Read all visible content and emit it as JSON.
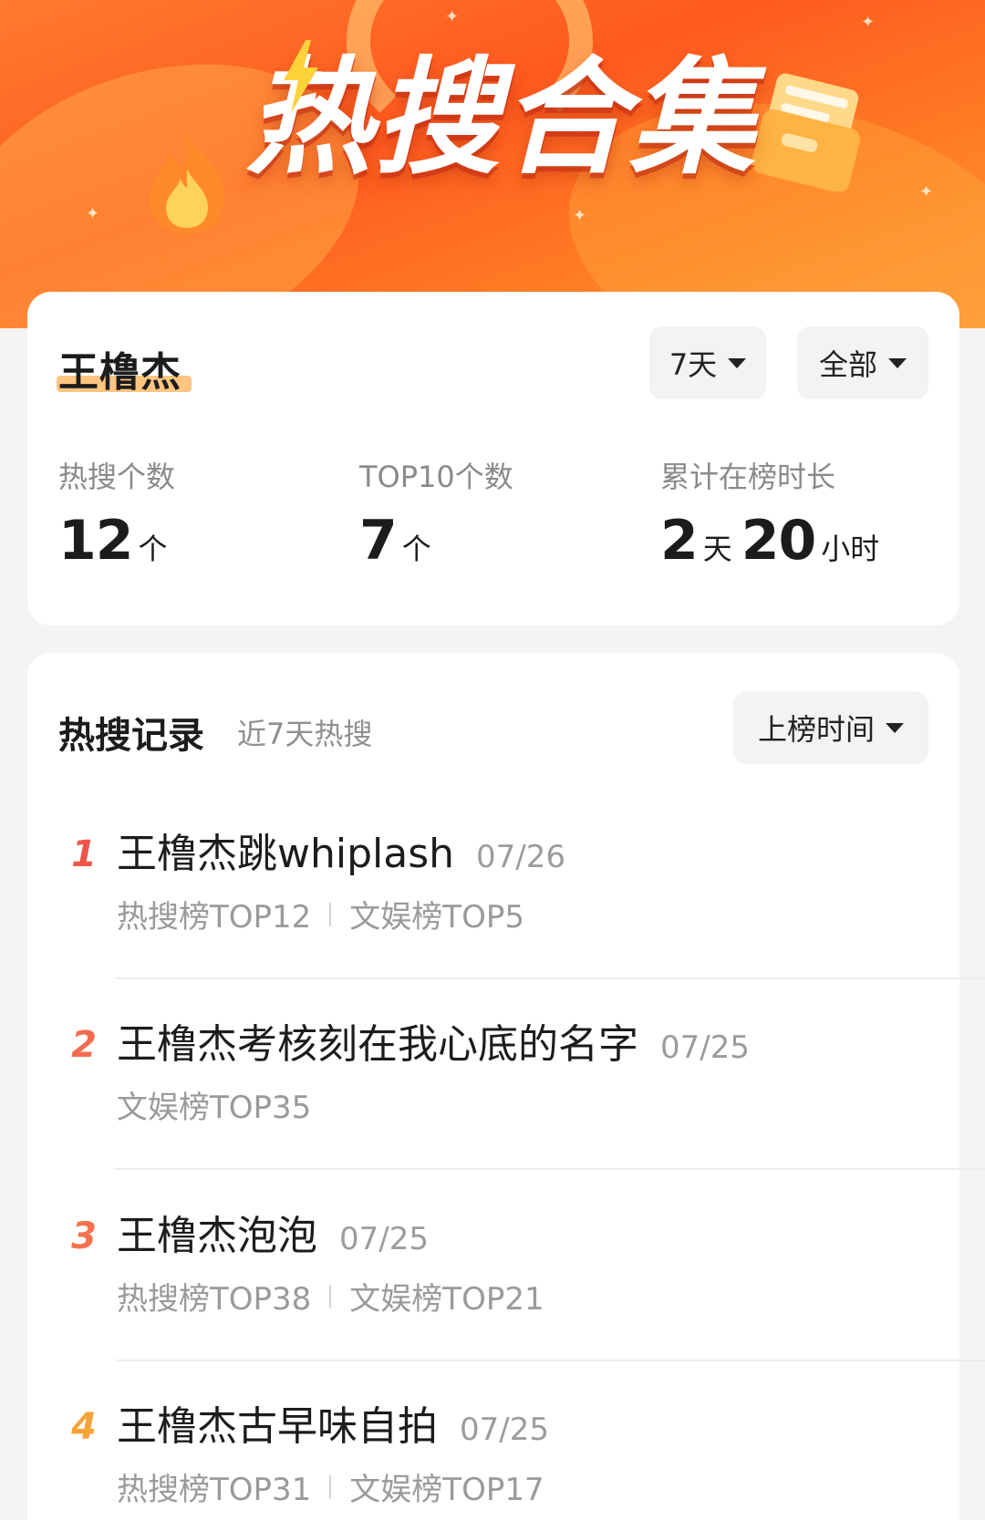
{
  "banner": {
    "title": "热搜合集",
    "icons": [
      "flame-icon",
      "folder-icon",
      "lightning-icon"
    ]
  },
  "summary": {
    "name": "王橹杰",
    "filters": {
      "days_label": "7天",
      "scope_label": "全部"
    },
    "stats": [
      {
        "label": "热搜个数",
        "value": "12",
        "unit": "个"
      },
      {
        "label": "TOP10个数",
        "value": "7",
        "unit": "个"
      },
      {
        "label": "累计在榜时长",
        "days": "2",
        "days_unit": "天",
        "hours": "20",
        "hours_unit": "小时"
      }
    ]
  },
  "records": {
    "title": "热搜记录",
    "subtitle": "近7天热搜",
    "sort_label": "上榜时间",
    "items": [
      {
        "rank": "1",
        "topic": "王橹杰跳whiplash",
        "date": "07/26",
        "tags": [
          "热搜榜TOP12",
          "文娱榜TOP5"
        ],
        "rank_color": "#f0554a"
      },
      {
        "rank": "2",
        "topic": "王橹杰考核刻在我心底的名字",
        "date": "07/25",
        "tags": [
          "文娱榜TOP35"
        ],
        "rank_color": "#f36b4f"
      },
      {
        "rank": "3",
        "topic": "王橹杰泡泡",
        "date": "07/25",
        "tags": [
          "热搜榜TOP38",
          "文娱榜TOP21"
        ],
        "rank_color": "#f4734e"
      },
      {
        "rank": "4",
        "topic": "王橹杰古早味自拍",
        "date": "07/25",
        "tags": [
          "热搜榜TOP31",
          "文娱榜TOP17"
        ],
        "rank_color": "#f5a33a"
      }
    ]
  },
  "colors": {
    "banner_orange": "#ff5a1f",
    "highlight": "#ffbf73",
    "rank_1": "#f0554a",
    "rank_4": "#f5a33a"
  }
}
